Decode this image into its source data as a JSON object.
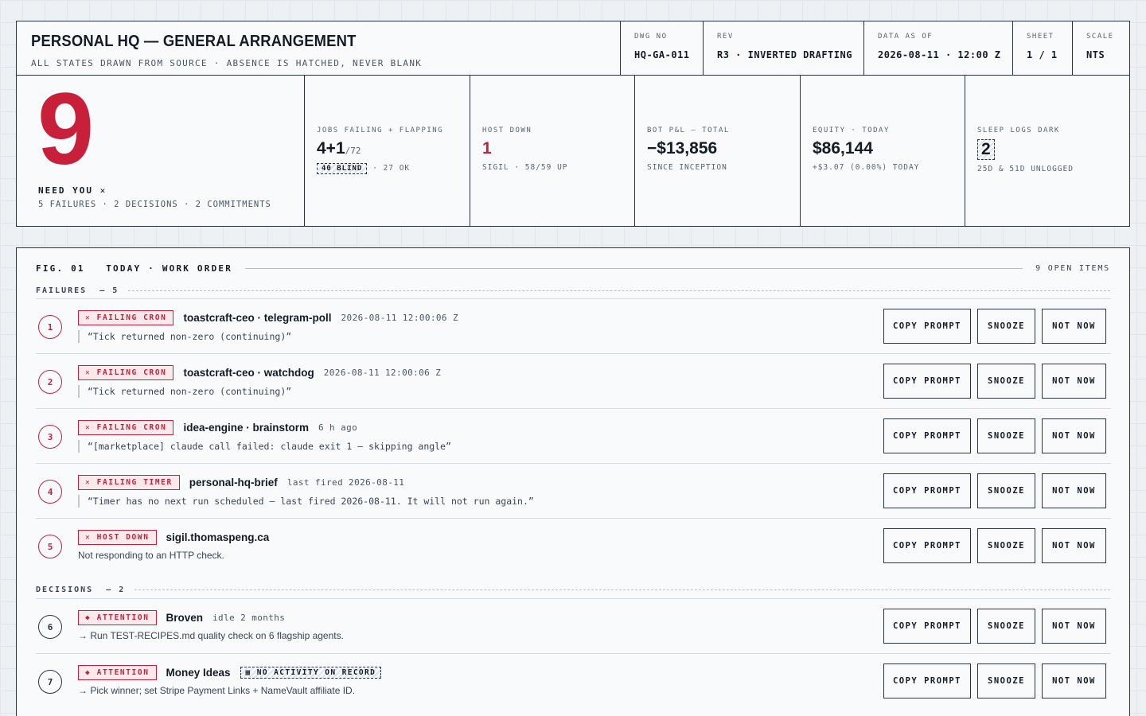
{
  "title_block": {
    "title": "PERSONAL HQ — GENERAL ARRANGEMENT",
    "subtitle": "ALL STATES DRAWN FROM SOURCE · ABSENCE IS HATCHED, NEVER BLANK",
    "meta": [
      {
        "label": "DWG NO",
        "value": "HQ-GA-011"
      },
      {
        "label": "REV",
        "value": "R3 · INVERTED DRAFTING"
      },
      {
        "label": "DATA AS OF",
        "value": "2026-08-11 · 12:00 Z"
      },
      {
        "label": "SHEET",
        "value": "1 / 1"
      },
      {
        "label": "SCALE",
        "value": "NTS"
      }
    ]
  },
  "hero": {
    "count": "9",
    "label": "NEED YOU ✕",
    "sub": "5 FAILURES · 2 DECISIONS · 2 COMMITMENTS"
  },
  "kpis": {
    "jobs": {
      "label": "JOBS FAILING + FLAPPING",
      "value": "4+1",
      "denominator": "/72",
      "blind_tag": "40 BLIND",
      "sub": "· 27 OK"
    },
    "host": {
      "label": "HOST DOWN",
      "value": "1",
      "sub": "SIGIL · 58/59 UP"
    },
    "bot": {
      "label": "BOT P&L — TOTAL",
      "value": "−$13,856",
      "sub": "SINCE INCEPTION"
    },
    "equity": {
      "label": "EQUITY · TODAY",
      "value": "$86,144",
      "sub": "+$3.07 (0.00%) TODAY"
    },
    "sleep": {
      "label": "SLEEP LOGS DARK",
      "value": "2",
      "sub": "25D & 51D UNLOGGED"
    }
  },
  "work_order": {
    "fig": "FIG. 01",
    "title": "TODAY · WORK ORDER",
    "open_items": "9 OPEN ITEMS",
    "failures_header": "FAILURES",
    "failures_count": "— 5",
    "decisions_header": "DECISIONS",
    "decisions_count": "— 2",
    "button_labels": {
      "copy": "COPY PROMPT",
      "snooze": "SNOOZE",
      "notnow": "NOT NOW"
    },
    "failures": [
      {
        "n": "1",
        "tag": "✕ FAILING CRON",
        "job": "toastcraft-ceo · telegram-poll",
        "when": "2026-08-11 12:00:06 Z",
        "detail": "“Tick returned non-zero (continuing)”"
      },
      {
        "n": "2",
        "tag": "✕ FAILING CRON",
        "job": "toastcraft-ceo · watchdog",
        "when": "2026-08-11 12:00:06 Z",
        "detail": "“Tick returned non-zero (continuing)”"
      },
      {
        "n": "3",
        "tag": "✕ FAILING CRON",
        "job": "idea-engine · brainstorm",
        "when": "6 h ago",
        "detail": "“[marketplace] claude call failed: claude exit 1 — skipping angle”"
      },
      {
        "n": "4",
        "tag": "✕ FAILING TIMER",
        "job": "personal-hq-brief",
        "when": "last fired 2026-08-11",
        "detail": "“Timer has no next run scheduled — last fired 2026-08-11. It will not run again.”"
      },
      {
        "n": "5",
        "tag": "✕ HOST DOWN",
        "job": "sigil.thomaspeng.ca",
        "when": "",
        "detail": "Not responding to an HTTP check."
      }
    ],
    "decisions": [
      {
        "n": "6",
        "tag": "◆ ATTENTION",
        "job": "Broven",
        "when": "idle 2 months",
        "hatch": "",
        "detail": "→ Run TEST-RECIPES.md quality check on 6 flagship agents."
      },
      {
        "n": "7",
        "tag": "◆ ATTENTION",
        "job": "Money Ideas",
        "when": "",
        "hatch": "▩ NO ACTIVITY ON RECORD",
        "detail": "→ Pick winner; set Stripe Payment Links + NameVault affiliate ID."
      }
    ]
  },
  "colors": {
    "accent_red": "#c8203a",
    "ink": "#141b24",
    "paper": "#f8fafc"
  }
}
